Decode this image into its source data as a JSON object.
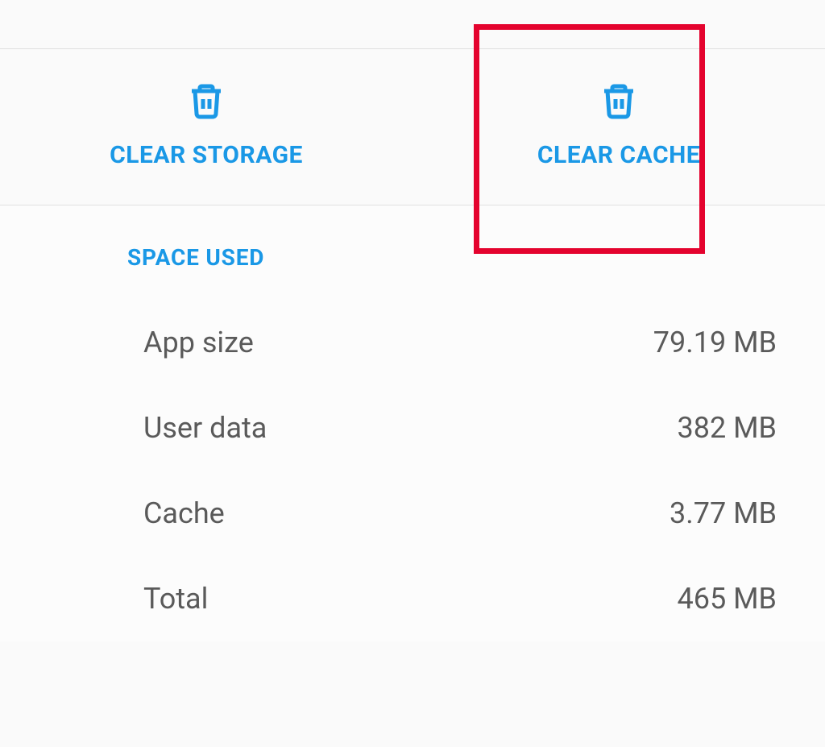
{
  "actions": {
    "clear_storage_label": "CLEAR STORAGE",
    "clear_cache_label": "CLEAR CACHE"
  },
  "section_header": "SPACE USED",
  "rows": [
    {
      "label": "App size",
      "value": "79.19 MB"
    },
    {
      "label": "User data",
      "value": "382 MB"
    },
    {
      "label": "Cache",
      "value": "3.77 MB"
    },
    {
      "label": "Total",
      "value": "465 MB"
    }
  ],
  "colors": {
    "accent": "#1a98e6",
    "highlight": "#e4032e"
  }
}
